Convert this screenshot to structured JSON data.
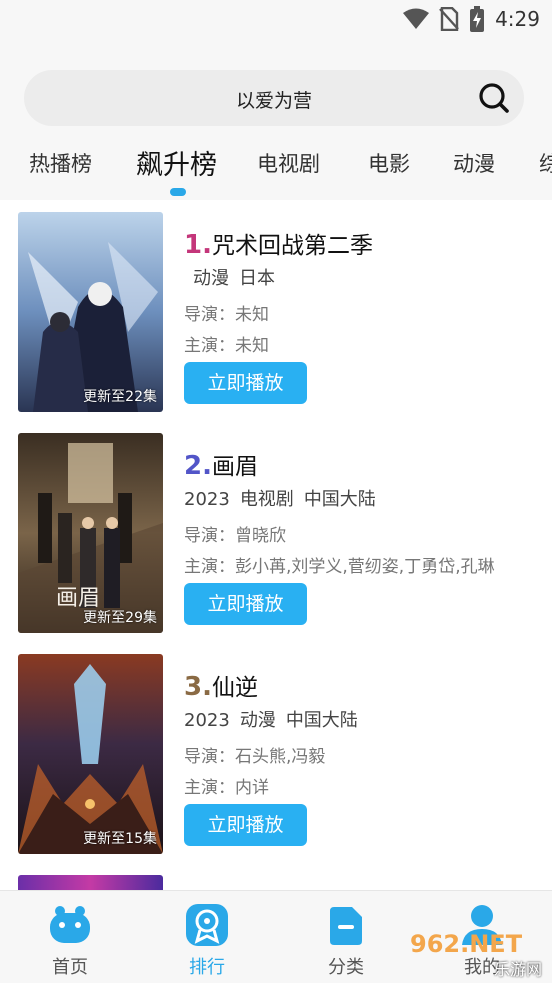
{
  "status": {
    "time": "4:29"
  },
  "search": {
    "text": "以爱为营"
  },
  "tabs": [
    {
      "label": "热播榜"
    },
    {
      "label": "飙升榜"
    },
    {
      "label": "电视剧"
    },
    {
      "label": "电影"
    },
    {
      "label": "动漫"
    },
    {
      "label": "综"
    }
  ],
  "items": [
    {
      "rank": "1.",
      "rank_color": "#c4367a",
      "title": "咒术回战第二季",
      "year": "",
      "type": "动漫",
      "region": "日本",
      "director": "导演：未知",
      "cast": "主演：未知",
      "badge": "更新至22集",
      "button": "立即播放"
    },
    {
      "rank": "2.",
      "rank_color": "#5255c8",
      "title": "画眉",
      "year": "2023",
      "type": "电视剧",
      "region": "中国大陆",
      "director": "导演：曾晓欣",
      "cast": "主演：彭小苒,刘学义,菅纫姿,丁勇岱,孔琳",
      "badge": "更新至29集",
      "button": "立即播放"
    },
    {
      "rank": "3.",
      "rank_color": "#8a6a44",
      "title": "仙逆",
      "year": "2023",
      "type": "动漫",
      "region": "中国大陆",
      "director": "导演：石头熊,冯毅",
      "cast": "主演：内详",
      "badge": "更新至15集",
      "button": "立即播放"
    }
  ],
  "nav": [
    {
      "label": "首页",
      "icon": "hippo-icon"
    },
    {
      "label": "排行",
      "icon": "ranking-icon"
    },
    {
      "label": "分类",
      "icon": "category-icon"
    },
    {
      "label": "我的",
      "icon": "user-icon"
    }
  ],
  "watermark": {
    "main": "962.NET",
    "sub": "乐游网"
  },
  "colors": {
    "accent": "#29b0f2",
    "active_tab_indicator": "#2aa8e8"
  }
}
